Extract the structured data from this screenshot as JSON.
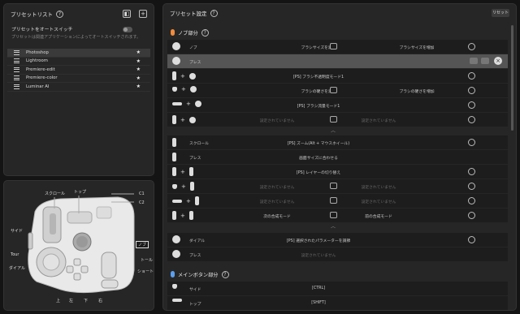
{
  "left": {
    "title": "プリセットリスト",
    "help": "?",
    "auto_label": "プリセットをオートスイッチ",
    "auto_sub": "プリセットは関連アプリケーションによってオートスイッチされます。",
    "presets": [
      {
        "name": "Photoshop",
        "selected": true
      },
      {
        "name": "Lightroom"
      },
      {
        "name": "Premiere-edit"
      },
      {
        "name": "Premiere-color"
      },
      {
        "name": "Luminar AI"
      }
    ],
    "star": "★"
  },
  "device": {
    "labels": {
      "scroll": "スクロール",
      "top": "トップ",
      "c1": "C1",
      "c2": "C2",
      "side": "サイド",
      "knob": "ノブ",
      "tour": "Tour",
      "dial": "ダイアル",
      "tall": "トール",
      "short": "ショート",
      "up": "上",
      "left": "左",
      "down": "下",
      "right": "右"
    }
  },
  "right": {
    "title": "プリセット設定",
    "help": "?",
    "reset": "リセット",
    "sec1": "ノブ部分",
    "sec2": "メインボタン部分",
    "rows1": [
      {
        "name": "ノブ",
        "a": "ブラシサイズを減少",
        "b": "ブラシサイズを増加"
      },
      {
        "name": "プレス",
        "a": "",
        "b": ""
      },
      {
        "name": "",
        "a": "[PS] ブラシ不透明度モード1",
        "b": ""
      },
      {
        "name": "",
        "a": "ブラシの硬さを減少",
        "b": "ブラシの硬さを増加"
      },
      {
        "name": "",
        "a": "[PS] ブラシ流量モード1",
        "b": ""
      },
      {
        "name": "",
        "a": "設定されていません",
        "b": "設定されていません"
      }
    ],
    "rows2": [
      {
        "name": "スクロール",
        "a": "[PS] ズーム(Alt + マウスホイール)"
      },
      {
        "name": "プレス",
        "a": "画面サイズに合わせる"
      },
      {
        "name": "",
        "a": "[PS] レイヤーの切り替え"
      },
      {
        "name": "",
        "a": "設定されていません",
        "b": "設定されていません"
      },
      {
        "name": "",
        "a": "設定されていません",
        "b": "設定されていません"
      },
      {
        "name": "",
        "a": "次の合成モード",
        "b": "前の合成モード"
      }
    ],
    "rows3": [
      {
        "name": "ダイアル",
        "a": "[PS] 選択されたパラメーターを調節"
      },
      {
        "name": "プレス",
        "a": "設定されていません"
      }
    ],
    "rows4": [
      {
        "name": "サイド",
        "a": "[CTRL]"
      },
      {
        "name": "トップ",
        "a": "[SHIFT]"
      }
    ],
    "chev": "︿",
    "close": "×",
    "colors": {
      "accent1": "#f28b3c",
      "accent2": "#5a9ff0"
    }
  }
}
